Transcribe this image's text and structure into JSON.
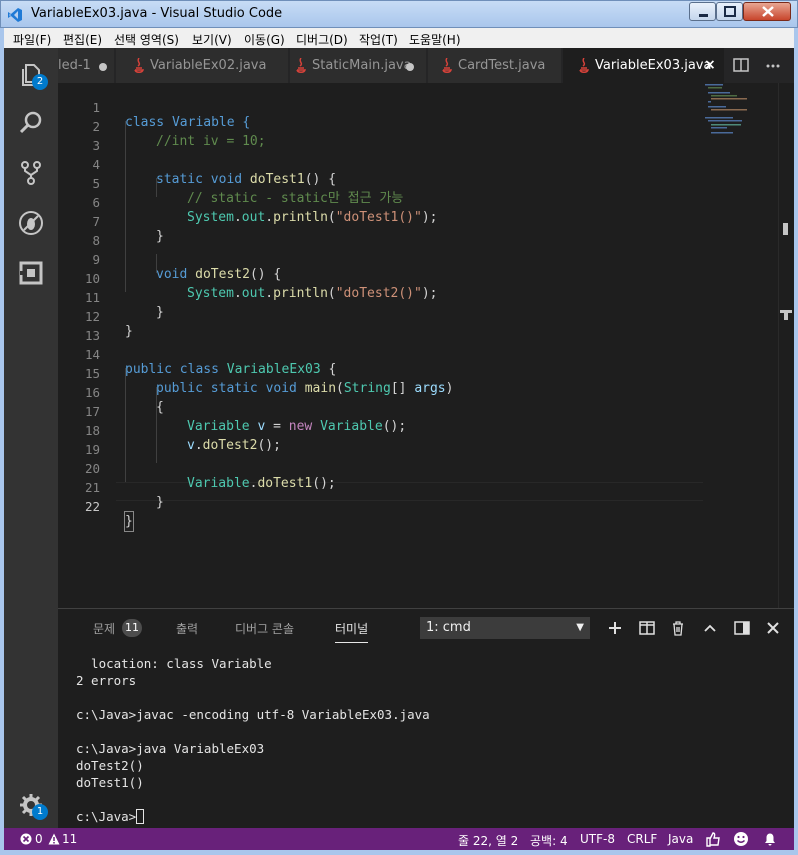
{
  "window": {
    "title": "VariableEx03.java - Visual Studio Code"
  },
  "menu": [
    "파일(F)",
    "편집(E)",
    "선택 영역(S)",
    "보기(V)",
    "이동(G)",
    "디버그(D)",
    "작업(T)",
    "도움말(H)"
  ],
  "activity": {
    "explorer_badge": "2",
    "settings_badge": "1"
  },
  "tabs": [
    {
      "label": "led-1",
      "dirty": true
    },
    {
      "label": "VariableEx02.java",
      "dirty": false
    },
    {
      "label": "StaticMain.java",
      "dirty": true
    },
    {
      "label": "CardTest.java",
      "dirty": false
    },
    {
      "label": "VariableEx03.java",
      "active": true
    }
  ],
  "editor": {
    "lines": [
      {
        "n": "1"
      },
      {
        "n": "2"
      },
      {
        "n": "3"
      },
      {
        "n": "4"
      },
      {
        "n": "5"
      },
      {
        "n": "6"
      },
      {
        "n": "7"
      },
      {
        "n": "8"
      },
      {
        "n": "9"
      },
      {
        "n": "10"
      },
      {
        "n": "11"
      },
      {
        "n": "12"
      },
      {
        "n": "13"
      },
      {
        "n": "14"
      },
      {
        "n": "15"
      },
      {
        "n": "16"
      },
      {
        "n": "17"
      },
      {
        "n": "18"
      },
      {
        "n": "19"
      },
      {
        "n": "20"
      },
      {
        "n": "21"
      },
      {
        "n": "22"
      }
    ],
    "code": {
      "l1": "class Variable {",
      "l2": "//int iv = 10;",
      "l4a": "static void ",
      "l4b": "doTest1",
      "l4c": "() {",
      "l5": "// static - static만 접근 가능",
      "l6a": "System",
      "l6b": ".",
      "l6c": "out",
      "l6d": ".",
      "l6e": "println",
      "l6f": "(",
      "l6g": "\"doTest1()\"",
      "l6h": ");",
      "l7": "}",
      "l9a": "void ",
      "l9b": "doTest2",
      "l9c": "() {",
      "l10a": "System",
      "l10b": ".",
      "l10c": "out",
      "l10d": ".",
      "l10e": "println",
      "l10f": "(",
      "l10g": "\"doTest2()\"",
      "l10h": ");",
      "l11": "}",
      "l12": "}",
      "l14a": "public class ",
      "l14b": "VariableEx03",
      "l14c": " {",
      "l15a": "public static void ",
      "l15b": "main",
      "l15c": "(",
      "l15d": "String",
      "l15e": "[] ",
      "l15f": "args",
      "l15g": ")",
      "l16": "{",
      "l17a": "Variable ",
      "l17b": "v",
      "l17c": " = ",
      "l17d": "new ",
      "l17e": "Variable",
      "l17f": "();",
      "l18a": "v",
      "l18b": ".",
      "l18c": "doTest2",
      "l18d": "();",
      "l20a": "Variable",
      "l20b": ".",
      "l20c": "doTest1",
      "l20d": "();",
      "l21": "}",
      "l22": "}"
    }
  },
  "panel": {
    "tabs": {
      "problems": "문제",
      "problems_count": "11",
      "output": "출력",
      "debug_console": "디버그 콘솔",
      "terminal": "터미널"
    },
    "terminal_select": "1: cmd",
    "terminal_lines": [
      "  location: class Variable",
      "2 errors",
      "",
      "c:\\Java>javac -encoding utf-8 VariableEx03.java",
      "",
      "c:\\Java>java VariableEx03",
      "doTest2()",
      "doTest1()",
      ""
    ],
    "prompt": "c:\\Java>"
  },
  "status": {
    "errors": "0",
    "warnings": "11",
    "position": "줄 22, 열 2",
    "spaces": "공백: 4",
    "encoding": "UTF-8",
    "eol": "CRLF",
    "language": "Java"
  },
  "colors": {
    "statusbar": "#68217a",
    "accent": "#007acc"
  }
}
